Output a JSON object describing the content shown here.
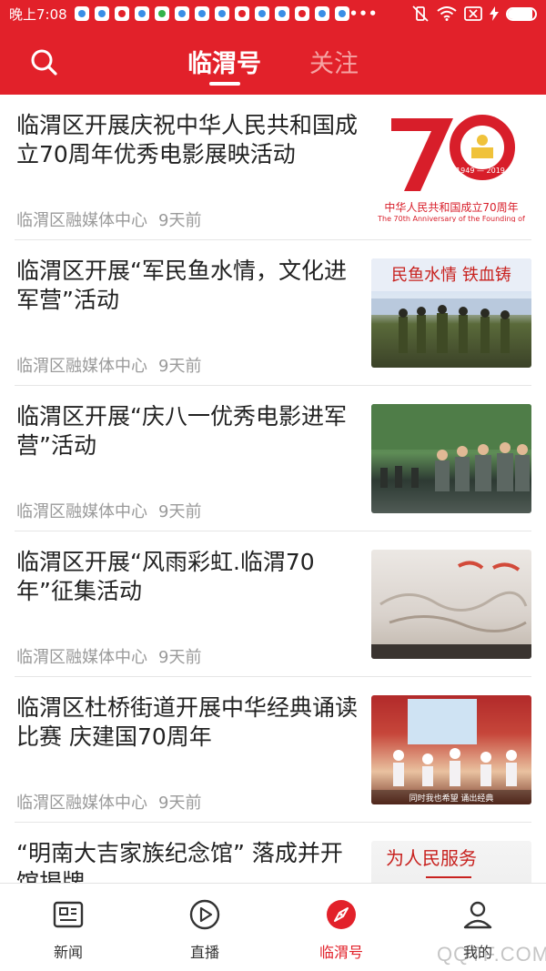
{
  "status_bar": {
    "time": "晚上7:08",
    "battery_level": 0.9
  },
  "header": {
    "tabs": [
      {
        "label": "临渭号",
        "active": true
      },
      {
        "label": "关注",
        "active": false
      }
    ],
    "accent_color": "#e2212a"
  },
  "feed": {
    "items": [
      {
        "title": "临渭区开展庆祝中华人民共和国成立70周年优秀电影展映活动",
        "source": "临渭区融媒体中心",
        "time": "9天前",
        "thumb_caption": "中华人民共和国成立70周年",
        "thumb_caption_en": "The 70th Anniversary of the Founding of",
        "thumb_years": "1949 — 2019"
      },
      {
        "title": "临渭区开展“军民鱼水情，文化进军营”活动",
        "source": "临渭区融媒体中心",
        "time": "9天前",
        "thumb_banner": "民鱼水情 铁血铸"
      },
      {
        "title": "临渭区开展“庆八一优秀电影进军营”活动",
        "source": "临渭区融媒体中心",
        "time": "9天前"
      },
      {
        "title": "临渭区开展“风雨彩虹.临渭70年”征集活动",
        "source": "临渭区融媒体中心",
        "time": "9天前"
      },
      {
        "title": "临渭区杜桥街道开展中华经典诵读比赛 庆建国70周年",
        "source": "临渭区融媒体中心",
        "time": "9天前",
        "thumb_caption": "同时我也希望 诵出经典"
      },
      {
        "title": "“明南大吉家族纪念馆” 落成并开馆揭牌",
        "source": "",
        "time": "",
        "thumb_banner": "为人民服务"
      }
    ]
  },
  "bottom_nav": {
    "items": [
      {
        "label": "新闻",
        "icon": "news-icon",
        "active": false
      },
      {
        "label": "直播",
        "icon": "play-icon",
        "active": false
      },
      {
        "label": "临渭号",
        "icon": "compass-icon",
        "active": true
      },
      {
        "label": "我的",
        "icon": "person-icon",
        "active": false
      }
    ]
  },
  "watermark": "QQTF.COM"
}
